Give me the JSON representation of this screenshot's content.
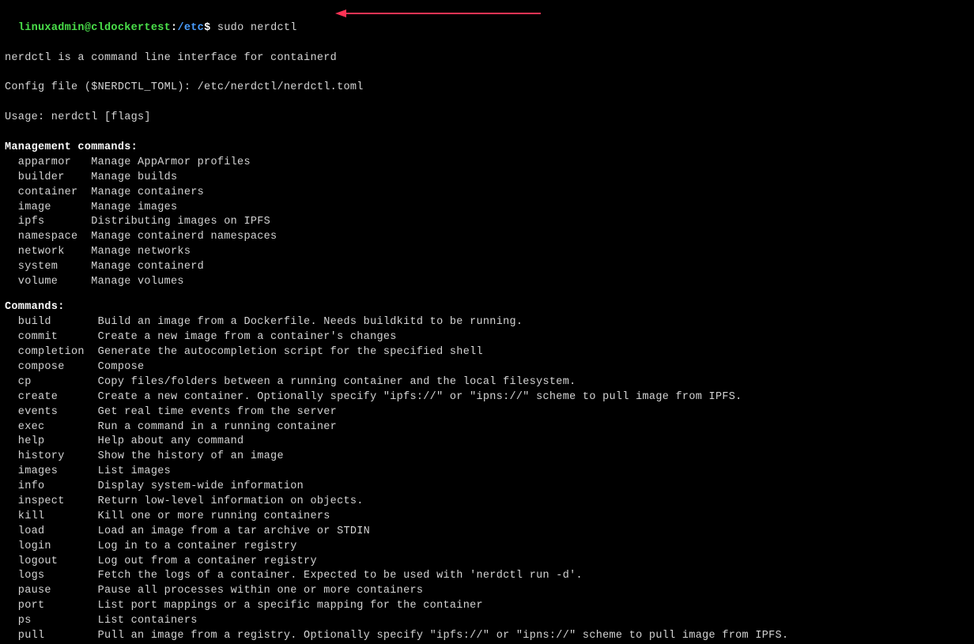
{
  "prompt": {
    "user_host": "linuxadmin@cldockertest",
    "colon": ":",
    "path": "/etc",
    "dollar": "$ ",
    "command": "sudo nerdctl"
  },
  "intro": [
    "nerdctl is a command line interface for containerd",
    "",
    "Config file ($NERDCTL_TOML): /etc/nerdctl/nerdctl.toml",
    "",
    "Usage: nerdctl [flags]",
    ""
  ],
  "management_header": "Management commands:",
  "management_commands": [
    "  apparmor   Manage AppArmor profiles",
    "  builder    Manage builds",
    "  container  Manage containers",
    "  image      Manage images",
    "  ipfs       Distributing images on IPFS",
    "  namespace  Manage containerd namespaces",
    "  network    Manage networks",
    "  system     Manage containerd",
    "  volume     Manage volumes"
  ],
  "commands_header": "Commands:",
  "commands": [
    "  build       Build an image from a Dockerfile. Needs buildkitd to be running.",
    "  commit      Create a new image from a container's changes",
    "  completion  Generate the autocompletion script for the specified shell",
    "  compose     Compose",
    "  cp          Copy files/folders between a running container and the local filesystem.",
    "  create      Create a new container. Optionally specify \"ipfs://\" or \"ipns://\" scheme to pull image from IPFS.",
    "  events      Get real time events from the server",
    "  exec        Run a command in a running container",
    "  help        Help about any command",
    "  history     Show the history of an image",
    "  images      List images",
    "  info        Display system-wide information",
    "  inspect     Return low-level information on objects.",
    "  kill        Kill one or more running containers",
    "  load        Load an image from a tar archive or STDIN",
    "  login       Log in to a container registry",
    "  logout      Log out from a container registry",
    "  logs        Fetch the logs of a container. Expected to be used with 'nerdctl run -d'.",
    "  pause       Pause all processes within one or more containers",
    "  port        List port mappings or a specific mapping for the container",
    "  ps          List containers",
    "  pull        Pull an image from a registry. Optionally specify \"ipfs://\" or \"ipns://\" scheme to pull image from IPFS."
  ],
  "arrow_color": "#ff3355"
}
